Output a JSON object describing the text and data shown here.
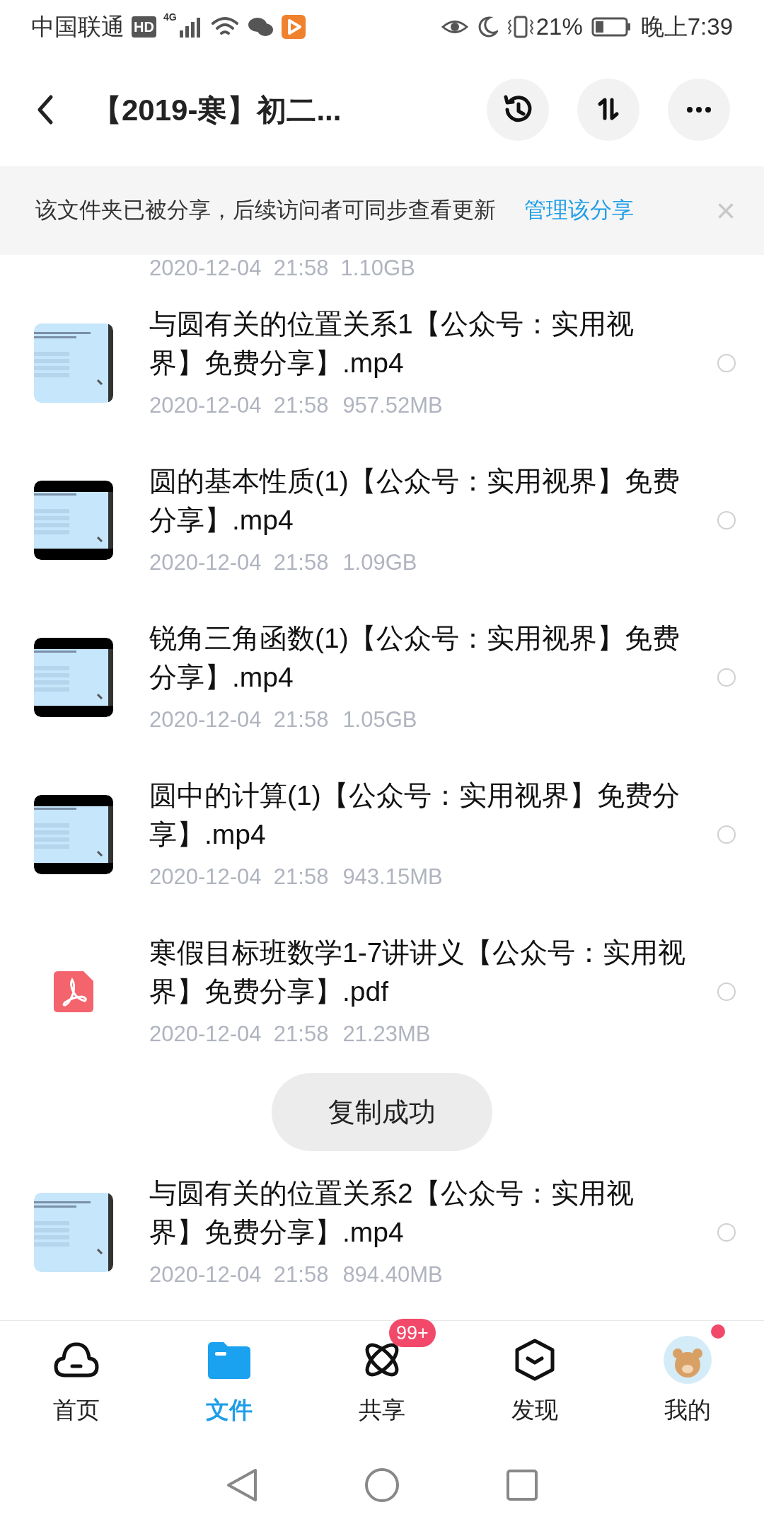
{
  "status_bar": {
    "carrier": "中国联通",
    "hd": "HD",
    "network": "4G",
    "battery_percent": "21%",
    "time": "晚上7:39"
  },
  "header": {
    "title": "【2019-寒】初二..."
  },
  "share_banner": {
    "message": "该文件夹已被分享，后续访问者可同步查看更新",
    "link": "管理该分享",
    "close": "×"
  },
  "top_partial_meta": "2020-12-04  21:58  1.10GB",
  "files": [
    {
      "kind": "video",
      "letterbox": false,
      "name": "与圆有关的位置关系1【公众号：实用视界】免费分享】.mp4",
      "date": "2020-12-04  21:58",
      "size": "957.52MB",
      "selected": false
    },
    {
      "kind": "video",
      "letterbox": true,
      "name": "圆的基本性质(1)【公众号：实用视界】免费分享】.mp4",
      "date": "2020-12-04  21:58",
      "size": "1.09GB",
      "selected": false
    },
    {
      "kind": "video",
      "letterbox": true,
      "name": "锐角三角函数(1)【公众号：实用视界】免费分享】.mp4",
      "date": "2020-12-04  21:58",
      "size": "1.05GB",
      "selected": false
    },
    {
      "kind": "video",
      "letterbox": true,
      "name": "圆中的计算(1)【公众号：实用视界】免费分享】.mp4",
      "date": "2020-12-04  21:58",
      "size": "943.15MB",
      "selected": false
    },
    {
      "kind": "pdf",
      "name": "寒假目标班数学1-7讲讲义【公众号：实用视界】免费分享】.pdf",
      "date": "2020-12-04  21:58",
      "size": "21.23MB",
      "selected": false
    },
    {
      "kind": "video",
      "letterbox": false,
      "name": "与圆有关的位置关系2【公众号：实用视界】免费分享】.mp4",
      "date": "2020-12-04  21:58",
      "size": "894.40MB",
      "selected": false
    }
  ],
  "toast": "复制成功",
  "tabs": [
    {
      "kind": "home",
      "label": "首页",
      "selected": false
    },
    {
      "kind": "files",
      "label": "文件",
      "selected": true
    },
    {
      "kind": "share",
      "label": "共享",
      "selected": false,
      "badge": "99+"
    },
    {
      "kind": "discover",
      "label": "发现",
      "selected": false
    },
    {
      "kind": "me",
      "label": "我的",
      "selected": false,
      "dot": true
    }
  ]
}
